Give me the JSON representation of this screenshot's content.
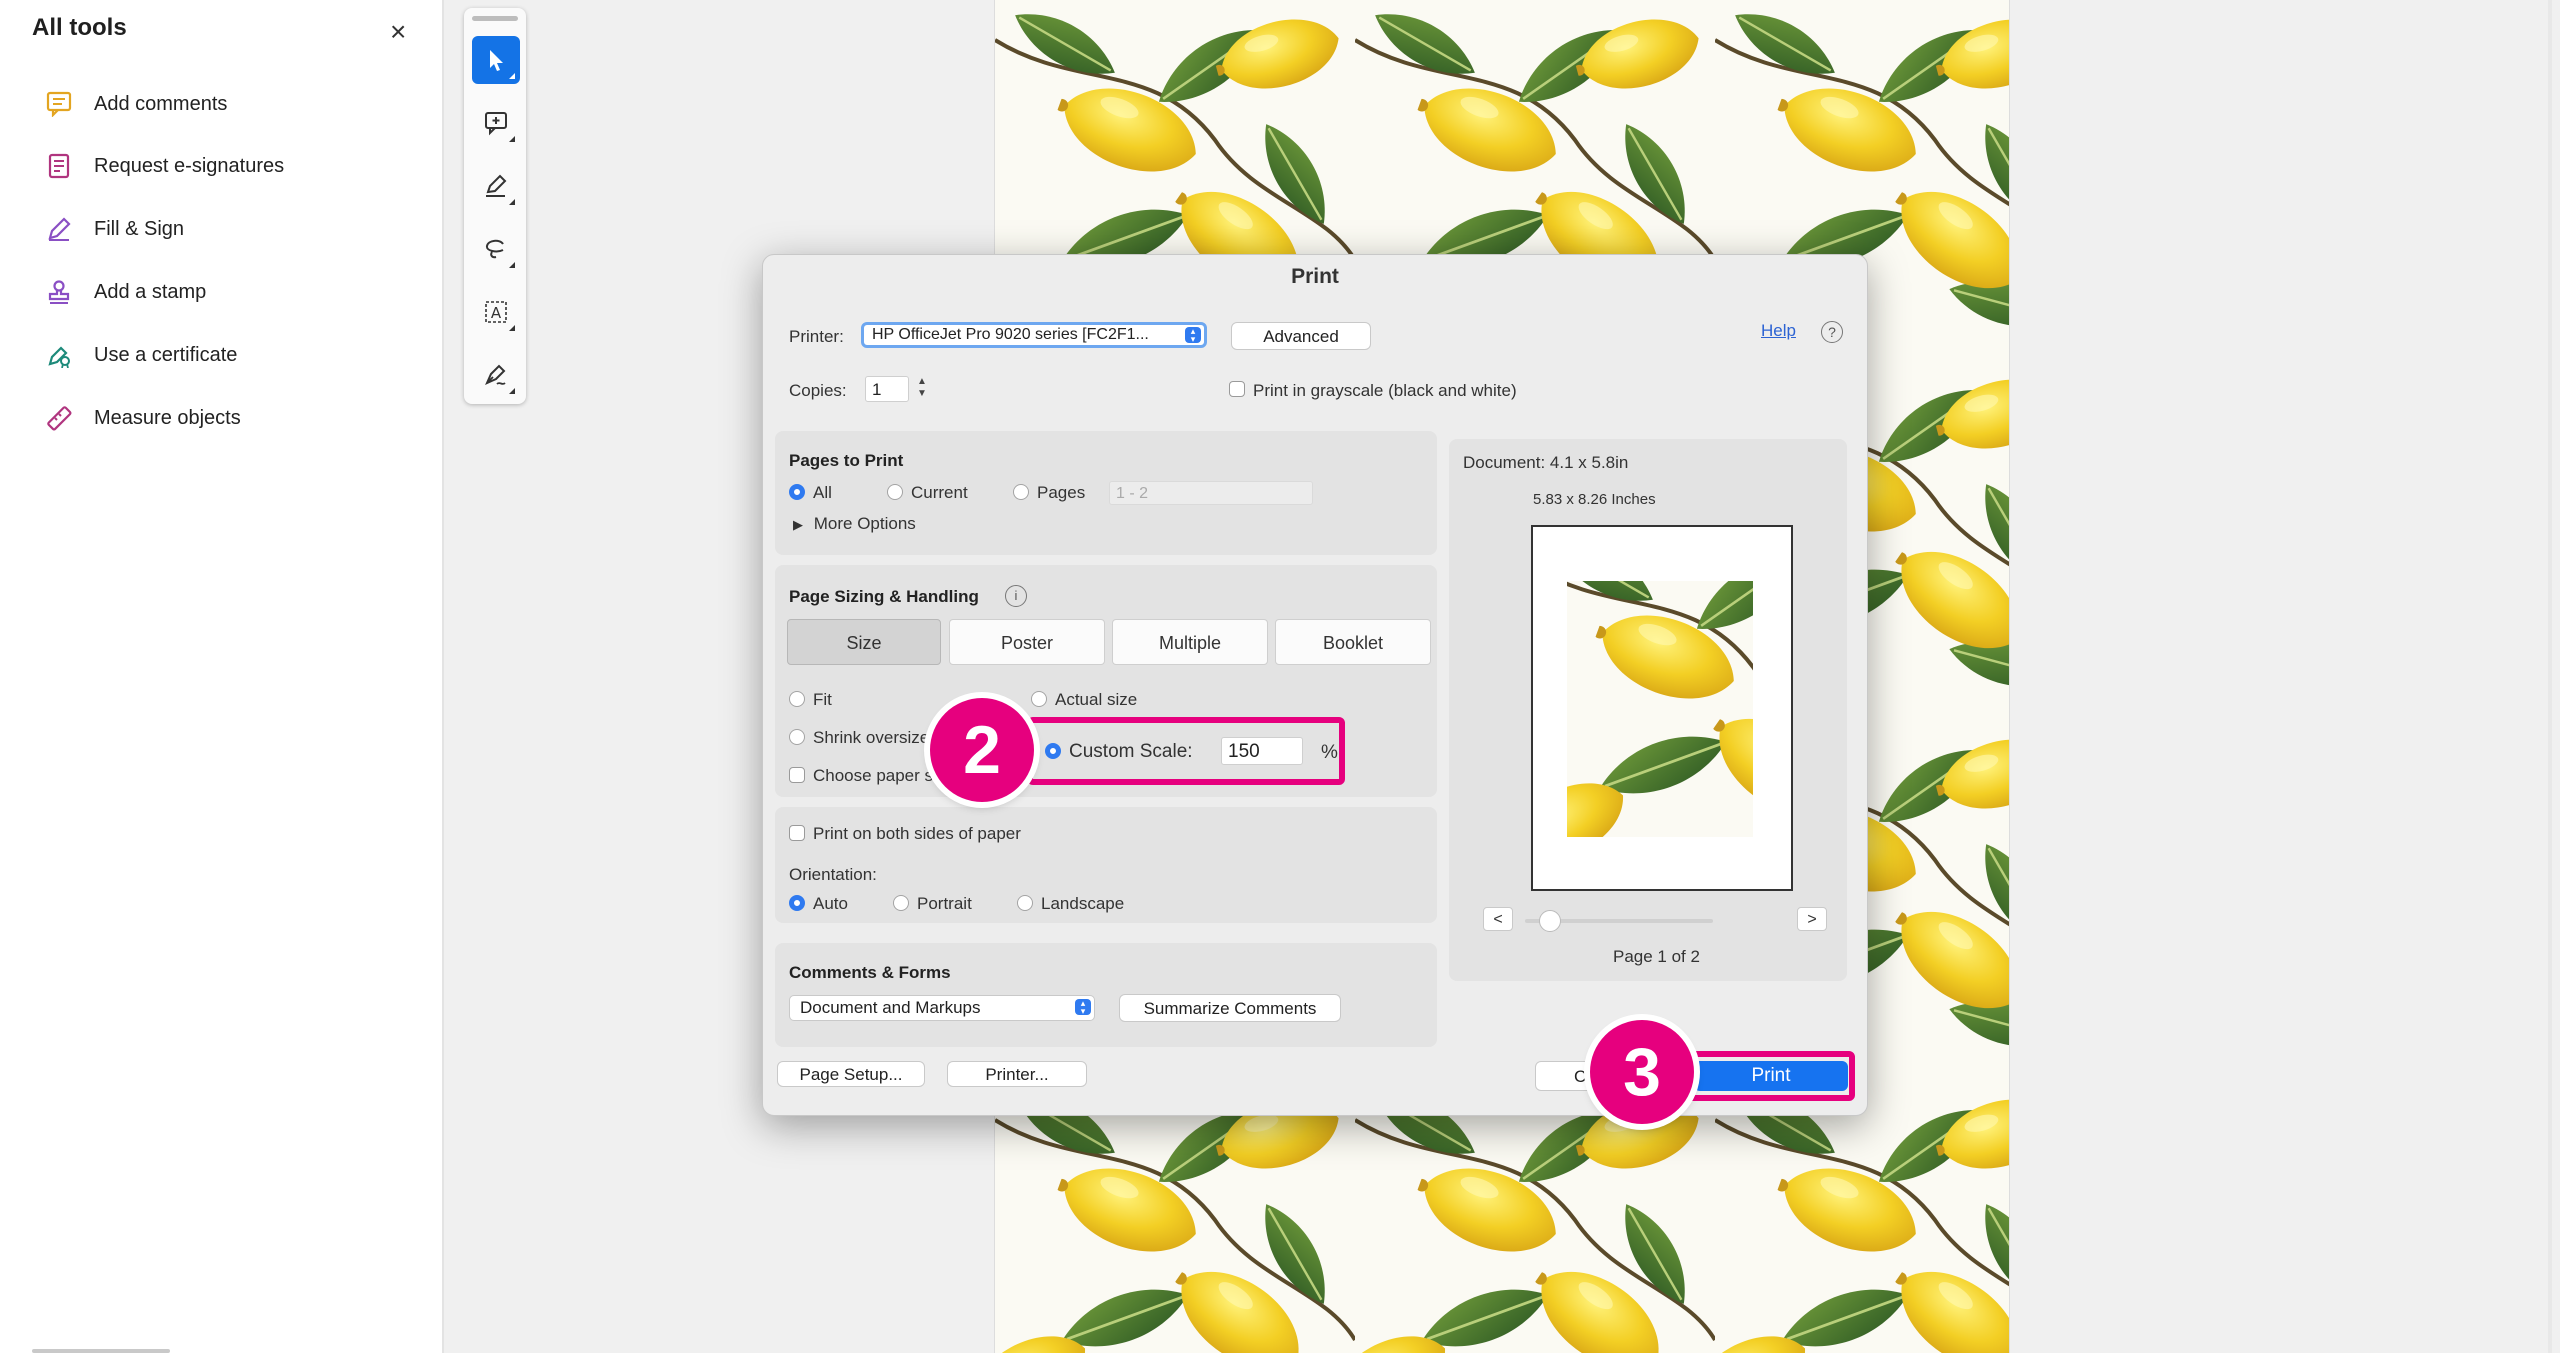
{
  "left_panel": {
    "title": "All tools",
    "close_label": "×",
    "items": [
      {
        "label": "Add comments",
        "icon": "comment-icon"
      },
      {
        "label": "Request e-signatures",
        "icon": "e-signature-icon"
      },
      {
        "label": "Fill & Sign",
        "icon": "pen-sign-icon"
      },
      {
        "label": "Add a stamp",
        "icon": "stamp-icon"
      },
      {
        "label": "Use a certificate",
        "icon": "certificate-icon"
      },
      {
        "label": "Measure objects",
        "icon": "ruler-icon"
      }
    ]
  },
  "toolbar": {
    "tools": [
      "select-pointer-icon",
      "add-comment-icon",
      "highlight-pen-icon",
      "lasso-draw-icon",
      "text-select-icon",
      "sign-pen-icon"
    ]
  },
  "dialog": {
    "title": "Print",
    "printer_label": "Printer:",
    "printer_value": "HP OfficeJet Pro 9020 series [FC2F1...",
    "advanced_label": "Advanced",
    "help_label": "Help",
    "help_icon": "?",
    "copies_label": "Copies:",
    "copies_value": "1",
    "grayscale_label": "Print in grayscale (black and white)",
    "pages_to_print": {
      "title": "Pages to Print",
      "all": "All",
      "current": "Current",
      "pages": "Pages",
      "range_placeholder": "1 - 2",
      "more_options": "More Options"
    },
    "sizing": {
      "title": "Page Sizing & Handling",
      "info_icon": "i",
      "tabs": [
        "Size",
        "Poster",
        "Multiple",
        "Booklet"
      ],
      "fit": "Fit",
      "actual_size": "Actual size",
      "shrink": "Shrink oversize",
      "choose_paper": "Choose paper s",
      "custom_scale_label": "Custom Scale:",
      "custom_scale_value": "150",
      "percent": "%"
    },
    "duplex_label": "Print on both sides of paper",
    "orientation": {
      "title": "Orientation:",
      "auto": "Auto",
      "portrait": "Portrait",
      "landscape": "Landscape"
    },
    "comments_forms": {
      "title": "Comments & Forms",
      "select_value": "Document and Markups",
      "summarize_label": "Summarize Comments"
    },
    "preview": {
      "document_size": "Document: 4.1 x 5.8in",
      "paper_size": "5.83 x 8.26 Inches",
      "prev": "<",
      "next": ">",
      "page_label": "Page 1 of 2"
    },
    "page_setup_label": "Page Setup...",
    "printer_btn_label": "Printer...",
    "cancel_label": "C",
    "print_label": "Print"
  },
  "annotations": {
    "step2": "2",
    "step3": "3",
    "accent_color": "#e6007e"
  }
}
